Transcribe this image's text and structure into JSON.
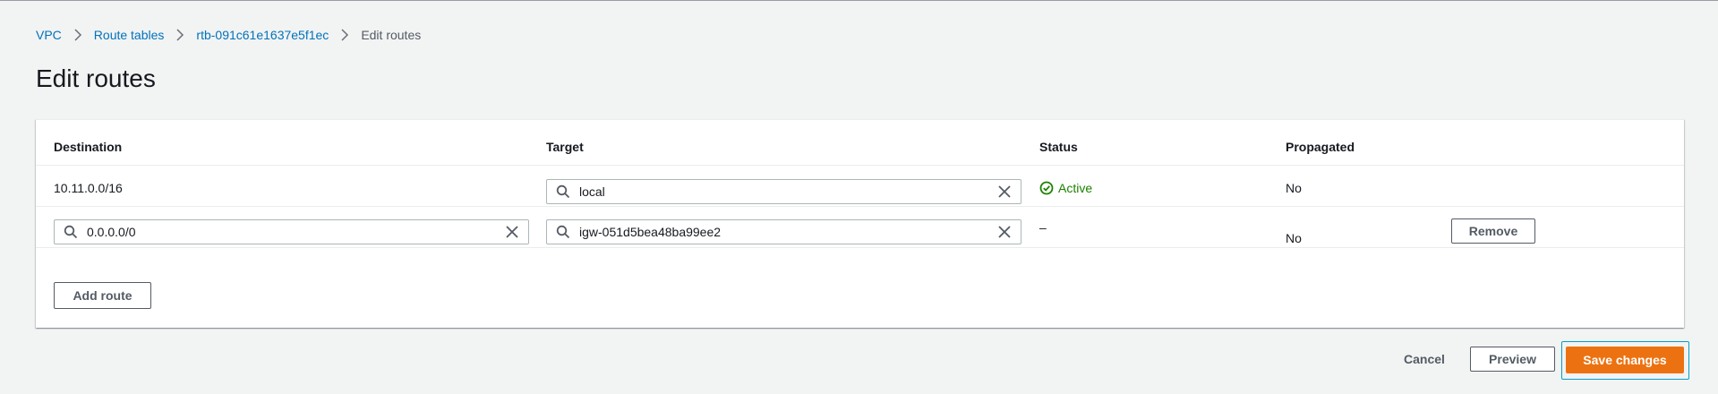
{
  "breadcrumb": {
    "items": [
      "VPC",
      "Route tables",
      "rtb-091c61e1637e5f1ec"
    ],
    "current": "Edit routes"
  },
  "page": {
    "title": "Edit routes"
  },
  "table": {
    "headers": {
      "destination": "Destination",
      "target": "Target",
      "status": "Status",
      "propagated": "Propagated"
    },
    "rows": [
      {
        "destination": "10.11.0.0/16",
        "target": "local",
        "status": "Active",
        "propagated": "No"
      },
      {
        "destination": "0.0.0.0/0",
        "target": "igw-051d5bea48ba99ee2",
        "status": "–",
        "propagated": "No",
        "remove_label": "Remove"
      }
    ],
    "add_route_label": "Add route"
  },
  "actions": {
    "cancel": "Cancel",
    "preview": "Preview",
    "save": "Save changes"
  },
  "colors": {
    "link": "#0073bb",
    "success": "#1d8102",
    "primary": "#ec7211",
    "focus": "#00a1c9"
  }
}
